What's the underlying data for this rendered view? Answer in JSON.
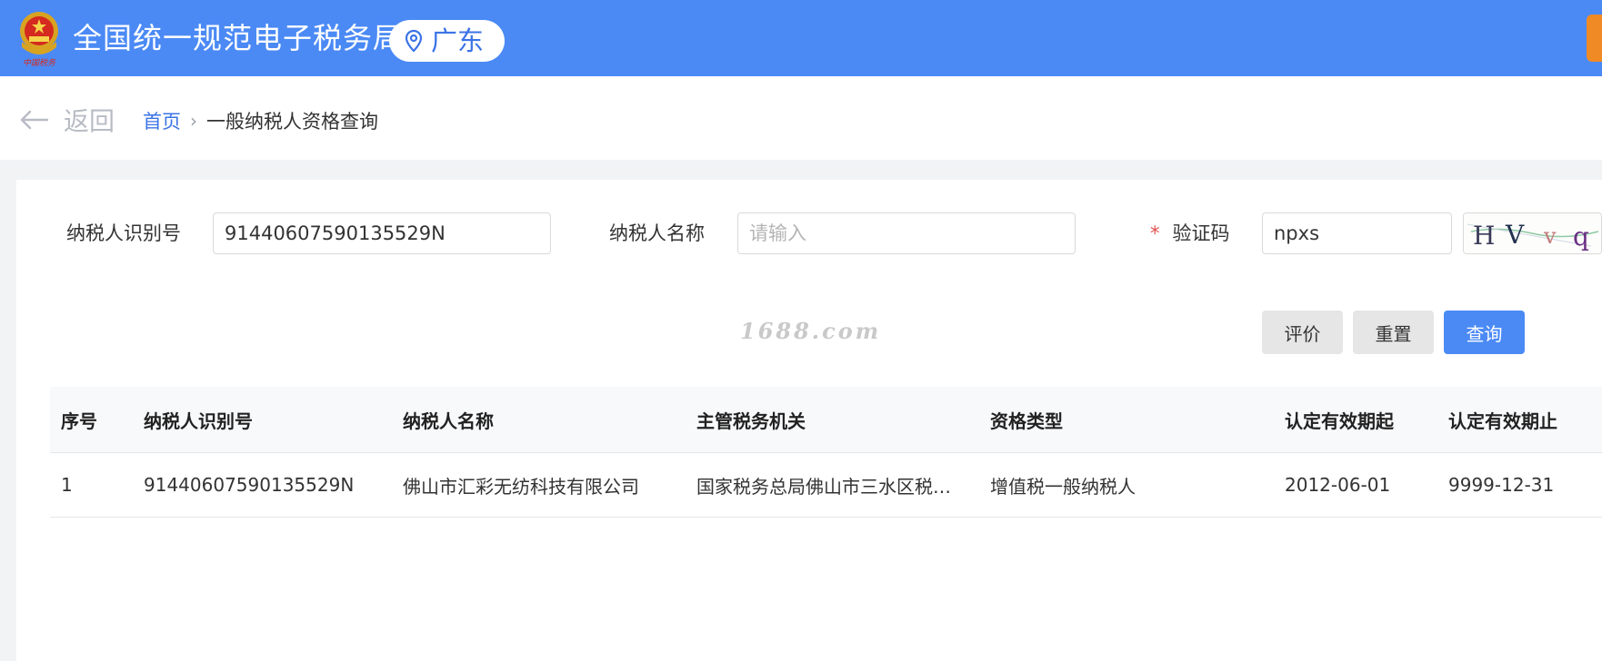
{
  "header": {
    "site_title": "全国统一规范电子税务局",
    "region": "广东",
    "emblem_icon": "national-emblem-icon",
    "pin_icon": "location-pin-icon",
    "brand_color": "#4b8af5"
  },
  "nav": {
    "back_label": "返回",
    "breadcrumb_home": "首页",
    "breadcrumb_separator": "›",
    "breadcrumb_current": "一般纳税人资格查询"
  },
  "form": {
    "taxpayer_id_label": "纳税人识别号",
    "taxpayer_id_value": "91440607590135529N",
    "taxpayer_name_label": "纳税人名称",
    "taxpayer_name_value": "",
    "taxpayer_name_placeholder": "请输入",
    "captcha_required_mark": "*",
    "captcha_label": "验证码",
    "captcha_value": "npxs",
    "captcha_image_text": "HVvq"
  },
  "watermark": "1688.com",
  "buttons": {
    "evaluate": "评价",
    "reset": "重置",
    "query": "查询"
  },
  "table": {
    "columns": [
      "序号",
      "纳税人识别号",
      "纳税人名称",
      "主管税务机关",
      "资格类型",
      "认定有效期起",
      "认定有效期止"
    ],
    "rows": [
      [
        "1",
        "91440607590135529N",
        "佛山市汇彩无纺科技有限公司",
        "国家税务总局佛山市三水区税…",
        "增值税一般纳税人",
        "2012-06-01",
        "9999-12-31"
      ]
    ]
  }
}
